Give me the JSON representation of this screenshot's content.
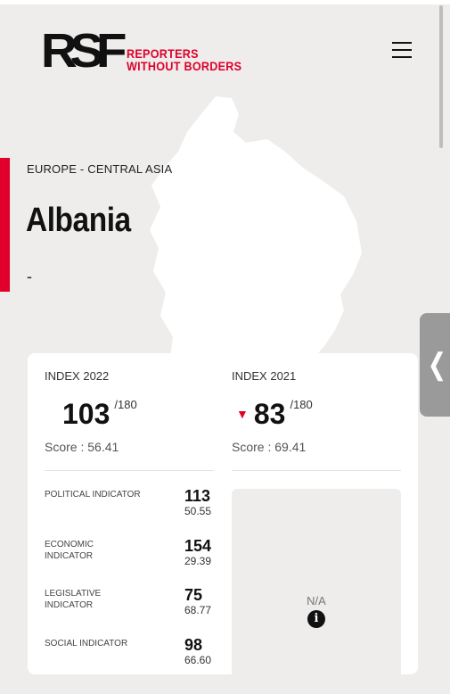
{
  "brand": {
    "mark": "RSF",
    "line1": "REPORTERS",
    "line2": "WITHOUT BORDERS",
    "accent_color": "#e0002b"
  },
  "header": {
    "menu_icon": "hamburger-menu-icon"
  },
  "country": {
    "region": "EUROPE - CENTRAL ASIA",
    "name": "Albania",
    "subtitle": "-"
  },
  "side_tab": {
    "icon": "chevron-left-icon",
    "glyph": "❬"
  },
  "index_2022": {
    "label": "INDEX 2022",
    "rank": "103",
    "out_of": "/180",
    "score": "Score : 56.41"
  },
  "index_2021": {
    "label": "INDEX 2021",
    "trend_icon": "down-triangle-icon",
    "rank": "83",
    "out_of": "/180",
    "score": "Score : 69.41"
  },
  "indicators": [
    {
      "name": "POLITICAL INDICATOR",
      "rank": "113",
      "score": "50.55"
    },
    {
      "name": "ECONOMIC INDICATOR",
      "rank": "154",
      "score": "29.39"
    },
    {
      "name": "LEGISLATIVE INDICATOR",
      "rank": "75",
      "score": "68.77"
    },
    {
      "name": "SOCIAL INDICATOR",
      "rank": "98",
      "score": "66.60"
    }
  ],
  "indicators_2021": {
    "na_text": "N/A",
    "info_icon": "info-icon"
  }
}
